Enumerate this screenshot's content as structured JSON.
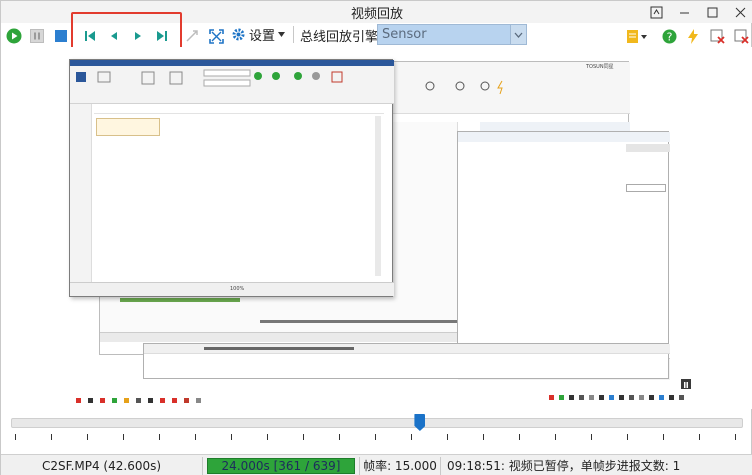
{
  "window": {
    "title": "视频回放"
  },
  "toolbar": {
    "settings_label": "设置",
    "engine_label": "总线回放引擎",
    "engine_value": "Sensor"
  },
  "embedded_screen": {
    "doc_ribbon_left": "TOSUN同星",
    "doc_status_zoom": "100%"
  },
  "seek": {
    "position_fraction": 0.56
  },
  "status": {
    "file": "C2SF.MP4 (42.600s)",
    "progress_text": "24.000s [361 / 639]",
    "progress_fraction": 0.565,
    "frame_rate": "帧率: 15.000",
    "message": "09:18:51: 视频已暂停，单帧步进报文数: 1"
  },
  "colors": {
    "highlight": "#e23b2e",
    "play": "#2ea43a",
    "accent": "#1a72c8",
    "engine_bg": "#b8d3ef"
  }
}
